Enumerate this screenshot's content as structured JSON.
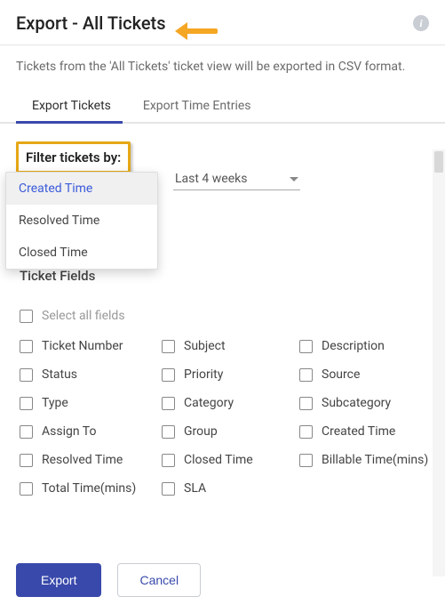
{
  "header": {
    "title": "Export - All Tickets"
  },
  "subtitle": "Tickets from the 'All Tickets' ticket view will be exported in CSV format.",
  "tabs": {
    "export_tickets": "Export Tickets",
    "export_time": "Export Time Entries"
  },
  "filter": {
    "label": "Filter tickets by:",
    "options": [
      "Created Time",
      "Resolved Time",
      "Closed Time"
    ],
    "range": "Last 4 weeks"
  },
  "ticket_fields": {
    "title": "Ticket Fields",
    "select_all": "Select all fields",
    "items": [
      "Ticket Number",
      "Subject",
      "Description",
      "Status",
      "Priority",
      "Source",
      "Type",
      "Category",
      "Subcategory",
      "Assign To",
      "Group",
      "Created Time",
      "Resolved Time",
      "Closed Time",
      "Billable Time(mins)",
      "Total Time(mins)",
      "SLA"
    ]
  },
  "buttons": {
    "export": "Export",
    "cancel": "Cancel"
  }
}
